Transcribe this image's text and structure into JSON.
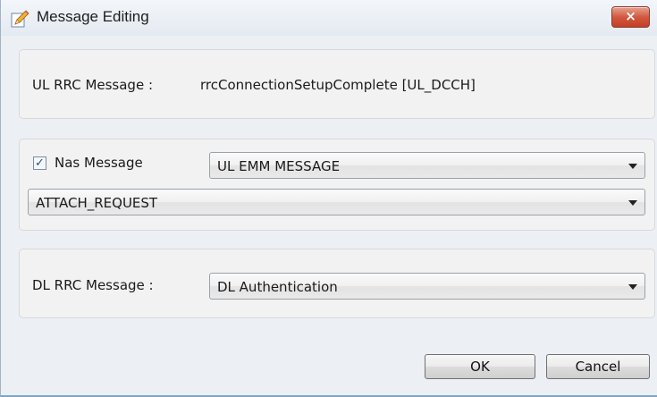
{
  "window": {
    "title": "Message Editing",
    "close_label": "×",
    "icons": {
      "app": "pencil-edit-icon",
      "close": "close-icon"
    }
  },
  "ul_section": {
    "label": "UL RRC Message :",
    "value": "rrcConnectionSetupComplete [UL_DCCH]"
  },
  "nas_section": {
    "checkbox_label": "Nas Message",
    "checked": true,
    "check_glyph": "✓",
    "message_type": "UL EMM MESSAGE",
    "message": "ATTACH_REQUEST"
  },
  "dl_section": {
    "label": "DL RRC Message :",
    "value": "DL Authentication"
  },
  "buttons": {
    "ok": "OK",
    "cancel": "Cancel"
  },
  "colors": {
    "close_button": "#c9472e",
    "dialog_background": "#eceff3",
    "group_background": "#f2f2f2"
  }
}
